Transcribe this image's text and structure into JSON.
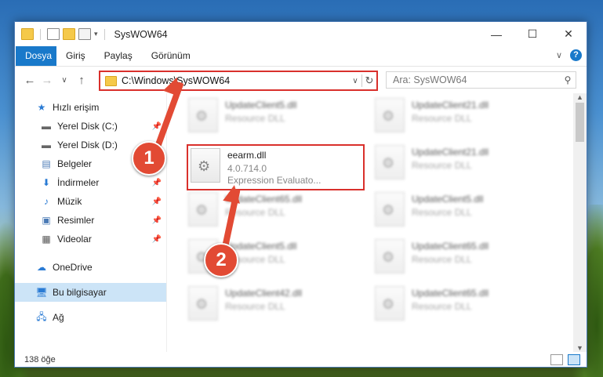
{
  "window": {
    "title": "SysWOW64",
    "minimize": "—",
    "maximize": "☐",
    "close": "✕"
  },
  "ribbon": {
    "tabs": [
      "Dosya",
      "Giriş",
      "Paylaş",
      "Görünüm"
    ],
    "expand": "∨",
    "help": "?"
  },
  "nav": {
    "back": "←",
    "forward": "→",
    "recent": "∨",
    "up": "↑",
    "address": "C:\\Windows\\SysWOW64",
    "address_drop": "∨",
    "refresh": "↻",
    "search_placeholder": "Ara: SysWOW64",
    "search_icon": "⚲"
  },
  "sidebar": {
    "items": [
      {
        "label": "Hızlı erişim",
        "icon": "star-icon"
      },
      {
        "label": "Yerel Disk (C:)",
        "icon": "drive-icon"
      },
      {
        "label": "Yerel Disk (D:)",
        "icon": "drive-icon"
      },
      {
        "label": "Belgeler",
        "icon": "documents-icon"
      },
      {
        "label": "İndirmeler",
        "icon": "download-icon"
      },
      {
        "label": "Müzik",
        "icon": "music-icon"
      },
      {
        "label": "Resimler",
        "icon": "pictures-icon"
      },
      {
        "label": "Videolar",
        "icon": "videos-icon"
      },
      {
        "label": "OneDrive",
        "icon": "cloud-icon"
      },
      {
        "label": "Bu bilgisayar",
        "icon": "computer-icon"
      },
      {
        "label": "Ağ",
        "icon": "network-icon"
      }
    ]
  },
  "files": [
    {
      "name": "UpdateClient5.dll",
      "desc": "Resource DLL"
    },
    {
      "name": "UpdateClient21.dll",
      "desc": "Resource DLL"
    },
    {
      "name": "UpdateClient21.dll",
      "desc": "Resource DLL"
    },
    {
      "name": "UpdateClient65.dll",
      "desc": "Resource DLL"
    },
    {
      "name": "UpdateClient5.dll",
      "desc": "Resource DLL"
    },
    {
      "name": "UpdateClient5.dll",
      "desc": "Resource DLL"
    },
    {
      "name": "UpdateClient65.dll",
      "desc": "Resource DLL"
    },
    {
      "name": "UpdateClient42.dll",
      "desc": "Resource DLL"
    },
    {
      "name": "UpdateClient65.dll",
      "desc": "Resource DLL"
    }
  ],
  "highlighted_file": {
    "name": "eearm.dll",
    "version": "4.0.714.0",
    "desc": "Expression Evaluato..."
  },
  "status": {
    "count": "138 öğe"
  },
  "annotations": {
    "badge1": "1",
    "badge2": "2",
    "color": "#e24a34"
  }
}
